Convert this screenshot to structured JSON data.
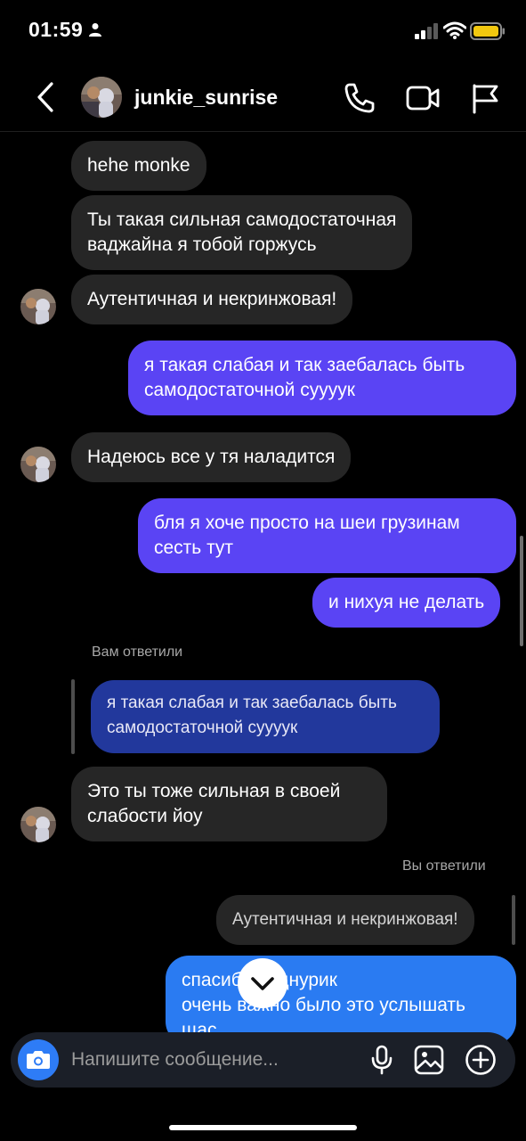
{
  "status_bar": {
    "time": "01:59",
    "icons": [
      "person-icon",
      "signal-icon",
      "wifi-icon",
      "battery-icon"
    ],
    "battery_color": "#f2c80f"
  },
  "header": {
    "username": "junkie_sunrise",
    "icons": [
      "back-arrow-icon",
      "phone-icon",
      "video-camera-icon",
      "flag-icon"
    ]
  },
  "messages": {
    "m1": "hehe monke",
    "m2": "Ты такая сильная самодостаточная\nваджайна я тобой горжусь",
    "m3": "Аутентичная и некринжовая!",
    "m4": "я такая слабая и так заебалась быть\nсамодостаточной суууук",
    "m5": "Надеюсь все у тя наладится",
    "m6": "бля я хоче просто на шеи грузинам\nсесть тут",
    "m7": "и нихуя не делать",
    "reply1_label": "Вам ответили",
    "reply1_quote": "я такая слабая и так заебалась быть\nсамодостаточной суууук",
    "m8": "Это ты тоже сильная в своей\nслабости йоу",
    "reply2_label": "Вы ответили",
    "reply2_quote": "Аутентичная и некринжовая!",
    "m9": "спасибо роднурик\nочень важно было это услышать\nщас"
  },
  "composer": {
    "placeholder": "Напишите сообщение...",
    "icons": [
      "camera-icon",
      "microphone-icon",
      "gallery-icon",
      "plus-circle-icon"
    ]
  },
  "colors": {
    "incoming_bubble": "#262626",
    "outgoing_bubble": "#5a44f4",
    "outgoing_bubble_latest": "#2a7bf2",
    "reply_quote": "#22389c",
    "composer_bg": "#1b1f28",
    "camera_button": "#2e7cf6"
  }
}
